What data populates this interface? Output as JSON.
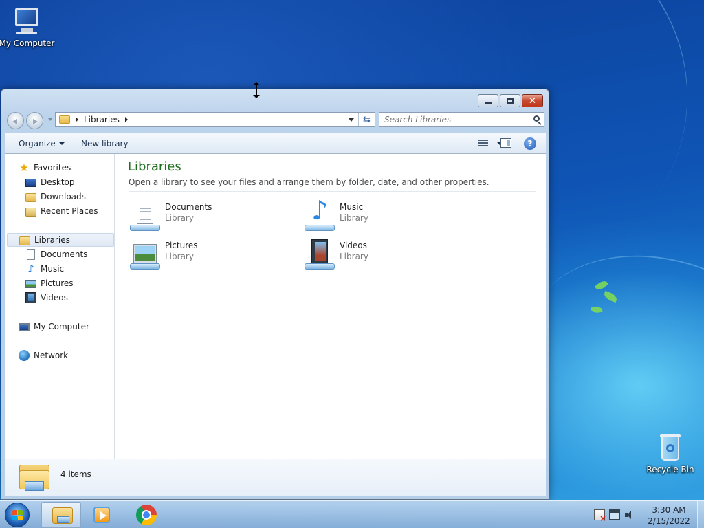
{
  "desktop": {
    "icons": [
      {
        "label": "My Computer",
        "icon": "computer-icon"
      },
      {
        "label": "Recycle Bin",
        "icon": "recycle-bin-icon"
      }
    ]
  },
  "window": {
    "address": {
      "crumbs": [
        "Libraries"
      ],
      "refresh_icon": "refresh-icon"
    },
    "search": {
      "placeholder": "Search Libraries",
      "value": ""
    },
    "toolbar": {
      "organize_label": "Organize",
      "new_library_label": "New library"
    },
    "nav_pane": {
      "favorites_label": "Favorites",
      "favorites": [
        "Desktop",
        "Downloads",
        "Recent Places"
      ],
      "libraries_label": "Libraries",
      "libraries": [
        "Documents",
        "Music",
        "Pictures",
        "Videos"
      ],
      "computer_label": "My Computer",
      "network_label": "Network"
    },
    "content": {
      "title": "Libraries",
      "subtitle": "Open a library to see your files and arrange them by folder, date, and other properties.",
      "items": [
        {
          "name": "Documents",
          "type": "Library",
          "icon": "documents-library-icon"
        },
        {
          "name": "Music",
          "type": "Library",
          "icon": "music-library-icon"
        },
        {
          "name": "Pictures",
          "type": "Library",
          "icon": "pictures-library-icon"
        },
        {
          "name": "Videos",
          "type": "Library",
          "icon": "videos-library-icon"
        }
      ]
    },
    "details": {
      "count": "4 items"
    }
  },
  "taskbar": {
    "apps": [
      "windows-explorer-icon",
      "media-player-icon",
      "chrome-icon"
    ],
    "clock": {
      "time": "3:30 AM",
      "date": "2/15/2022"
    },
    "accent": "#1d5fb5"
  }
}
